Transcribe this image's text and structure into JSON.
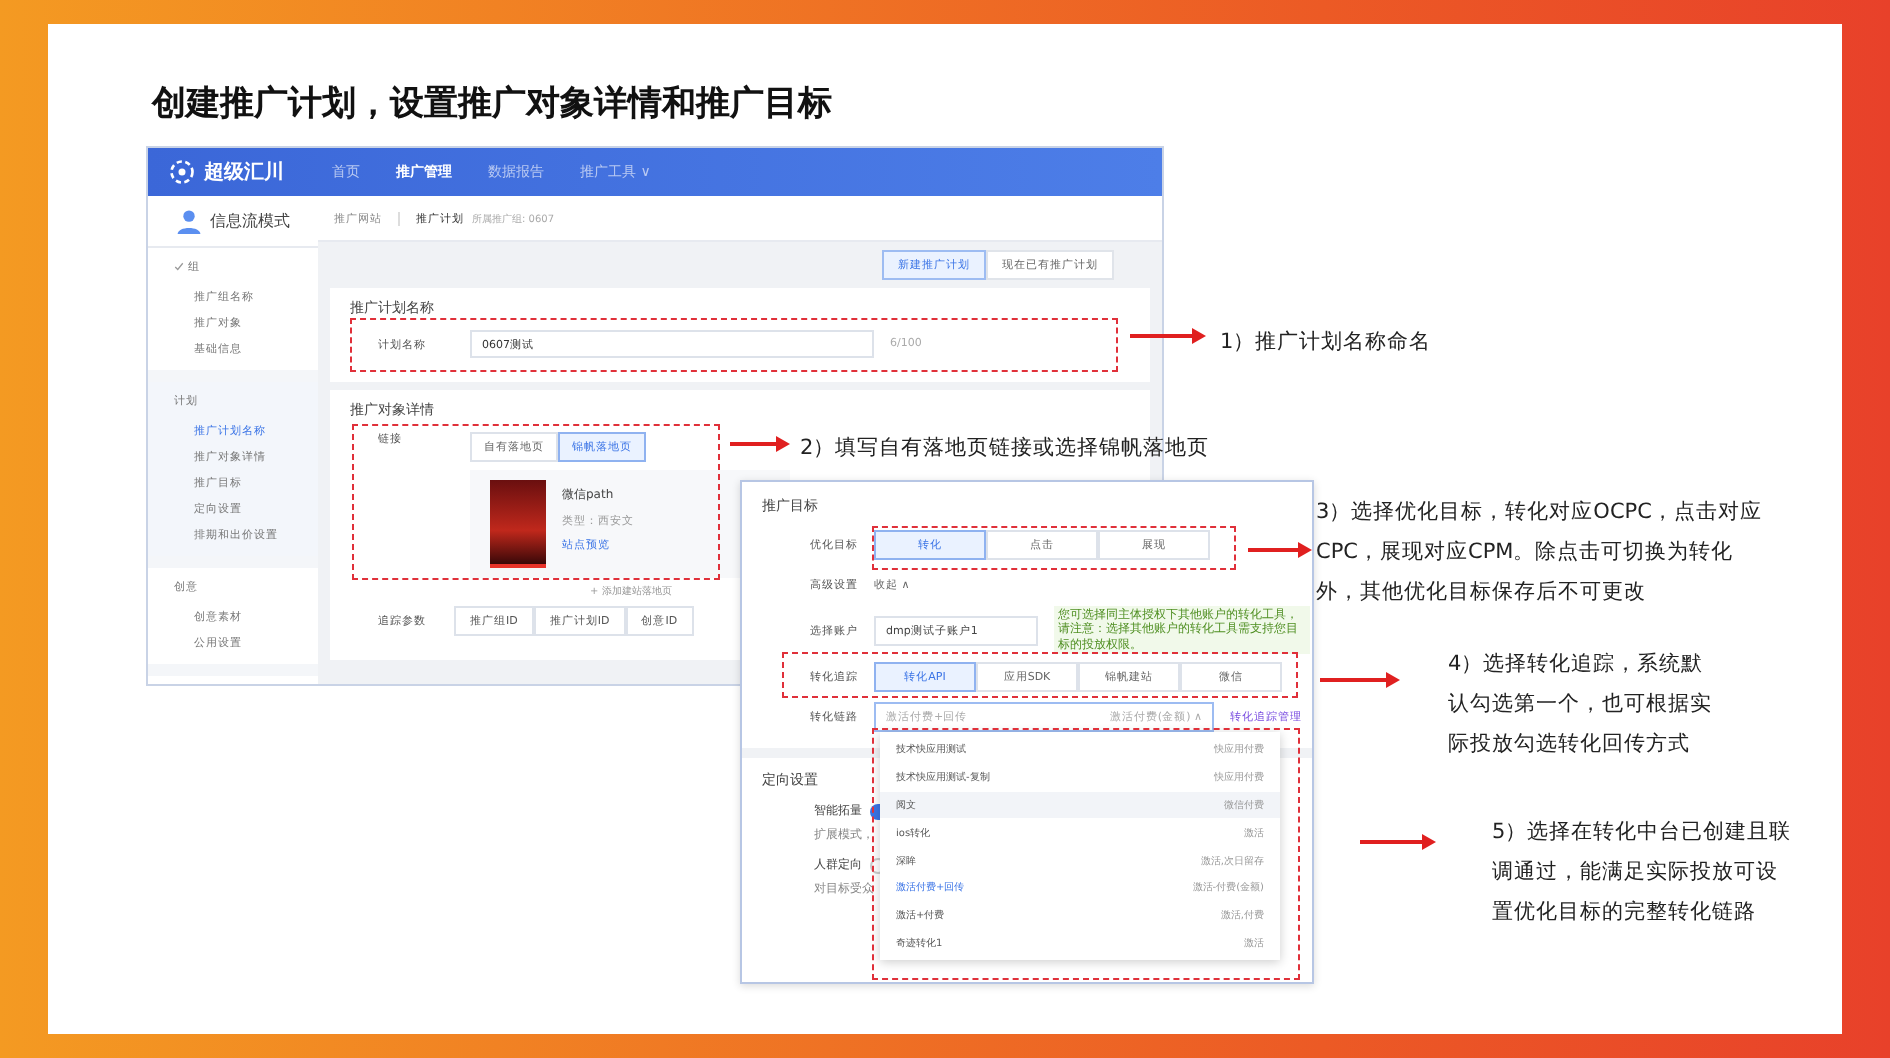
{
  "title": "创建推广计划，设置推广对象详情和推广目标",
  "app": {
    "logo": "超级汇川",
    "nav": [
      {
        "label": "首页",
        "selected": false
      },
      {
        "label": "推广管理",
        "selected": true
      },
      {
        "label": "数据报告",
        "selected": false
      },
      {
        "label": "推广工具 ∨",
        "selected": false
      }
    ],
    "mode": "信息流模式",
    "breadcrumb": [
      "推广网站",
      "推广计划"
    ],
    "breadcrumb_note": "所属推广组: 0607",
    "sidebar": [
      {
        "title": "组",
        "done": true,
        "items": [
          {
            "label": "推广组名称",
            "selected": false
          },
          {
            "label": "推广对象",
            "selected": false
          },
          {
            "label": "基础信息",
            "selected": false
          }
        ]
      },
      {
        "title": "计划",
        "done": false,
        "items": [
          {
            "label": "推广计划名称",
            "selected": true
          },
          {
            "label": "推广对象详情",
            "selected": false
          },
          {
            "label": "推广目标",
            "selected": false
          },
          {
            "label": "定向设置",
            "selected": false
          },
          {
            "label": "排期和出价设置",
            "selected": false
          }
        ]
      },
      {
        "title": "创意",
        "done": false,
        "items": [
          {
            "label": "创意素材",
            "selected": false
          },
          {
            "label": "公用设置",
            "selected": false
          }
        ]
      }
    ],
    "plan_tabs": [
      {
        "label": "新建推广计划",
        "selected": true
      },
      {
        "label": "现在已有推广计划",
        "selected": false
      }
    ],
    "name_section": {
      "title": "推广计划名称",
      "label": "计划名称",
      "value": "0607测试",
      "count": "6/100"
    },
    "object_section": {
      "title": "推广对象详情",
      "link_label": "链接",
      "link_tabs": [
        {
          "label": "自有落地页",
          "selected": false
        },
        {
          "label": "锦帆落地页",
          "selected": true
        }
      ],
      "page_card": {
        "name": "微信path",
        "type": "类型：西安文",
        "action": "站点预览"
      },
      "add": "+ 添加建站落地页",
      "track_label": "追踪参数",
      "track_params": [
        "推广组ID",
        "推广计划ID",
        "创意ID"
      ]
    }
  },
  "goal_panel": {
    "title": "推广目标",
    "goal_label": "优化目标",
    "goals": [
      {
        "label": "转化",
        "selected": true
      },
      {
        "label": "点击",
        "selected": false
      },
      {
        "label": "展现",
        "selected": false
      }
    ],
    "advanced_label": "高级设置",
    "advanced_value": "收起 ∧",
    "account_label": "选择账户",
    "account_value": "dmp测试子账户1",
    "account_tip": "您可选择同主体授权下其他账户的转化工具，请注意：选择其他账户的转化工具需支持您目标的投放权限。",
    "track_label": "转化追踪",
    "tracks": [
      {
        "label": "转化API",
        "selected": true
      },
      {
        "label": "应用SDK",
        "selected": false
      },
      {
        "label": "锦帆建站",
        "selected": false
      },
      {
        "label": "微信",
        "selected": false
      }
    ],
    "chain_label": "转化链路",
    "chain_placeholder": "激活付费+回传",
    "chain_value": "激活付费(金额) ∧",
    "chain_link": "转化追踪管理",
    "targeting_title": "定向设置",
    "targeting": [
      {
        "label": "智能拓量",
        "on": true,
        "hint": "扩展模式，"
      },
      {
        "label": "人群定向",
        "on": false,
        "hint": "对目标受众"
      }
    ],
    "options": [
      {
        "name": "技术快应用测试",
        "type": "快应用付费",
        "hover": false,
        "selected": false
      },
      {
        "name": "技术快应用测试-复制",
        "type": "快应用付费",
        "hover": false,
        "selected": false
      },
      {
        "name": "阅文",
        "type": "微信付费",
        "hover": true,
        "selected": false
      },
      {
        "name": "ios转化",
        "type": "激活",
        "hover": false,
        "selected": false
      },
      {
        "name": "深眸",
        "type": "激活,次日留存",
        "hover": false,
        "selected": false
      },
      {
        "name": "激活付费+回传",
        "type": "激活-付费(金额)",
        "hover": false,
        "selected": true
      },
      {
        "name": "激活+付费",
        "type": "激活,付费",
        "hover": false,
        "selected": false
      },
      {
        "name": "奇迹转化1",
        "type": "激活",
        "hover": false,
        "selected": false
      }
    ]
  },
  "notes": [
    "1）推广计划名称命名",
    "2）填写自有落地页链接或选择锦帆落地页",
    "3）选择优化目标，转化对应OCPC，点击对应CPC，展现对应CPM。除点击可切换为转化外，其他优化目标保存后不可更改",
    "4）选择转化追踪，系统默认勾选第一个，也可根据实际投放勾选转化回传方式",
    "5）选择在转化中台已创建且联调通过，能满足实际投放可设置优化目标的完整转化链路"
  ]
}
